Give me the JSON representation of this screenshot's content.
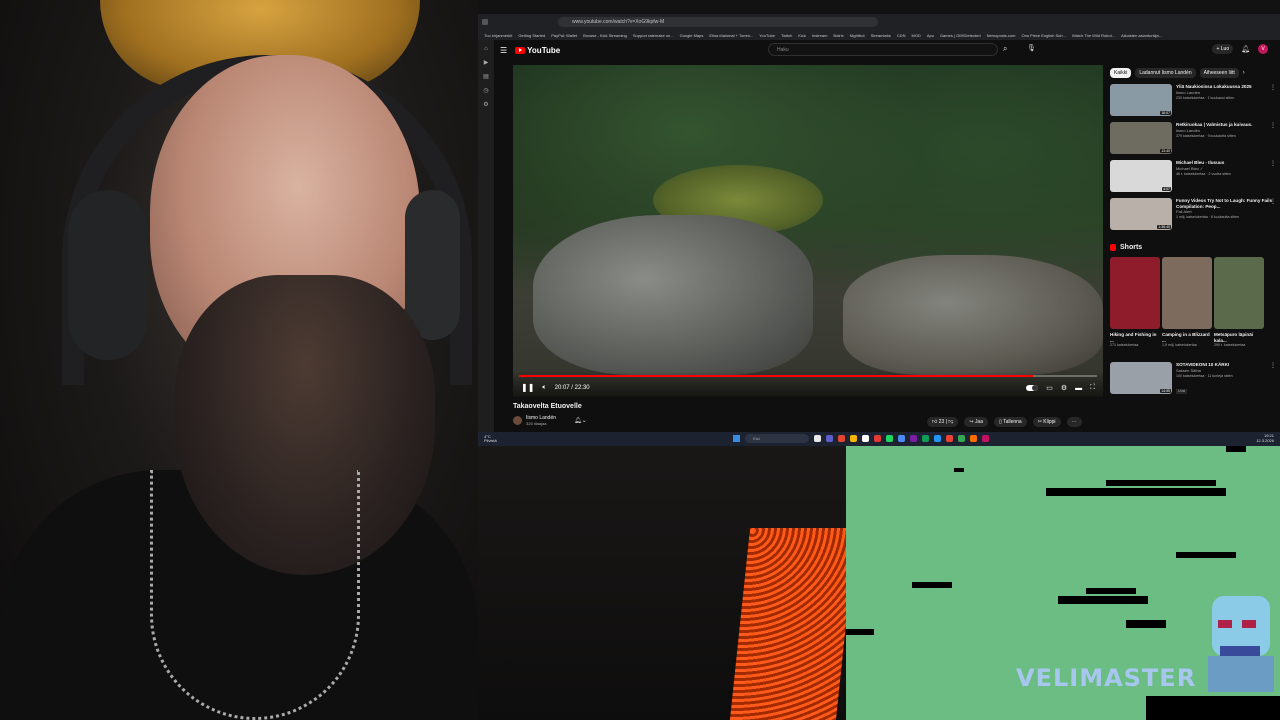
{
  "browser": {
    "url": "www.youtube.com/watch?v=XoG9kpfw-M",
    "bookmarks": [
      "Tuo kirjanmerkit",
      "Getting Started",
      "PayPal: Wallet",
      "Browse - Kick Streaming",
      "Support ratemake on...",
      "Google Maps",
      "Elina Malomal + Tomm...",
      "YouTube",
      "Twitch",
      "Kick",
      "Instream",
      "Botrix",
      "Nightbot",
      "Streamlabs",
      "CDN",
      "MOD",
      "Apu",
      "Games | OBSDetected",
      "Nemoposts.com",
      "Onu Piece English Sub...",
      "Watch The Wild Robot...",
      "Aikuisten asiantuntija..."
    ],
    "rail_icons": [
      "home-icon",
      "shorts-icon",
      "subs-icon",
      "history-icon",
      "settings-icon"
    ]
  },
  "youtube": {
    "logo_text": "YouTube",
    "search_placeholder": "Haku",
    "new_button": "+ Luo",
    "avatar_letter": "V"
  },
  "player": {
    "time": "20:07 / 22:30",
    "progress": 0.89
  },
  "video": {
    "title": "Takaovelta Etuovelle",
    "channel": "Iismo Landén",
    "subscribers": "326 tilaajaa",
    "likes": "23",
    "share": "Jaa",
    "save": "Tallenna",
    "clip": "Klippi"
  },
  "sidebar": {
    "chips": [
      "Kaikki",
      "Ladannut Iismo Landén",
      "Aiheeseen liitt"
    ],
    "recommendations": [
      {
        "title": "Yliä Naukiosissa Lokakuussa 2025",
        "channel": "Iismo Landén",
        "stats": "230 katselukertaa · 1 kuukausi sitten",
        "duration": "16:07",
        "color": "#8a9aa4"
      },
      {
        "title": "Retkiruokaa | Valmistus ja kuivaus.",
        "channel": "Iismo Landén",
        "stats": "379 katselukertaa · 9 kuukautta sitten",
        "duration": "13:40",
        "color": "#6e6b60"
      },
      {
        "title": "Michael Bleu - Ilusuus",
        "channel": "Michael Bleu ✓",
        "stats": "46 t. katselukertaa · 2 vuotta sitten",
        "duration": "4:07",
        "color": "#d9d9d9"
      },
      {
        "title": "Funny Videos Try Not to Laugh: Funny Fails Compilation: Peop...",
        "channel": "Fail Alert",
        "stats": "1 milj. katselukertaa · 8 kuukautta sitten",
        "duration": "1:36:40",
        "color": "#b9b0aa"
      }
    ],
    "shorts_label": "Shorts",
    "shorts": [
      {
        "title": "Hiking and Fishing in ...",
        "views": "271 katselukertaa",
        "color": "#8e1c2a"
      },
      {
        "title": "Camping in a Blizzard ...",
        "views": "1,9 milj. katselukertaa",
        "color": "#7d6b5e"
      },
      {
        "title": "Metsäpuro läpinäi kala...",
        "views": "290 t. katselukertaa",
        "color": "#5b6a4b"
      }
    ],
    "last_rec": {
      "title": "SOTAVIDEONI 10 KÄRKI",
      "channel": "Saksen Sätha",
      "stats": "100 katselukertaa · 11 tunteja sitten",
      "badge": "Uusi",
      "duration": "14:55",
      "color": "#9aa0a8"
    }
  },
  "taskbar": {
    "weather_temp": "4°C",
    "weather_text": "Pilvistä",
    "search_text": "Etsi",
    "app_colors": [
      "#e8e8e8",
      "#5b5fc7",
      "#e2442f",
      "#f4b400",
      "#ffffff",
      "#e53935",
      "#1ed760",
      "#4c8bf5",
      "#7b1fa2",
      "#0f9d58",
      "#2196f3",
      "#ea4335",
      "#34a853",
      "#ff6d00",
      "#c51162"
    ],
    "time": "19:21",
    "date": "12.3.2026"
  },
  "overlay": {
    "brand": "VELIMASTER"
  },
  "colors": {
    "game_bg": "#6bbd83",
    "brand_text": "#a8c7ef",
    "progress": "#ff0000"
  }
}
